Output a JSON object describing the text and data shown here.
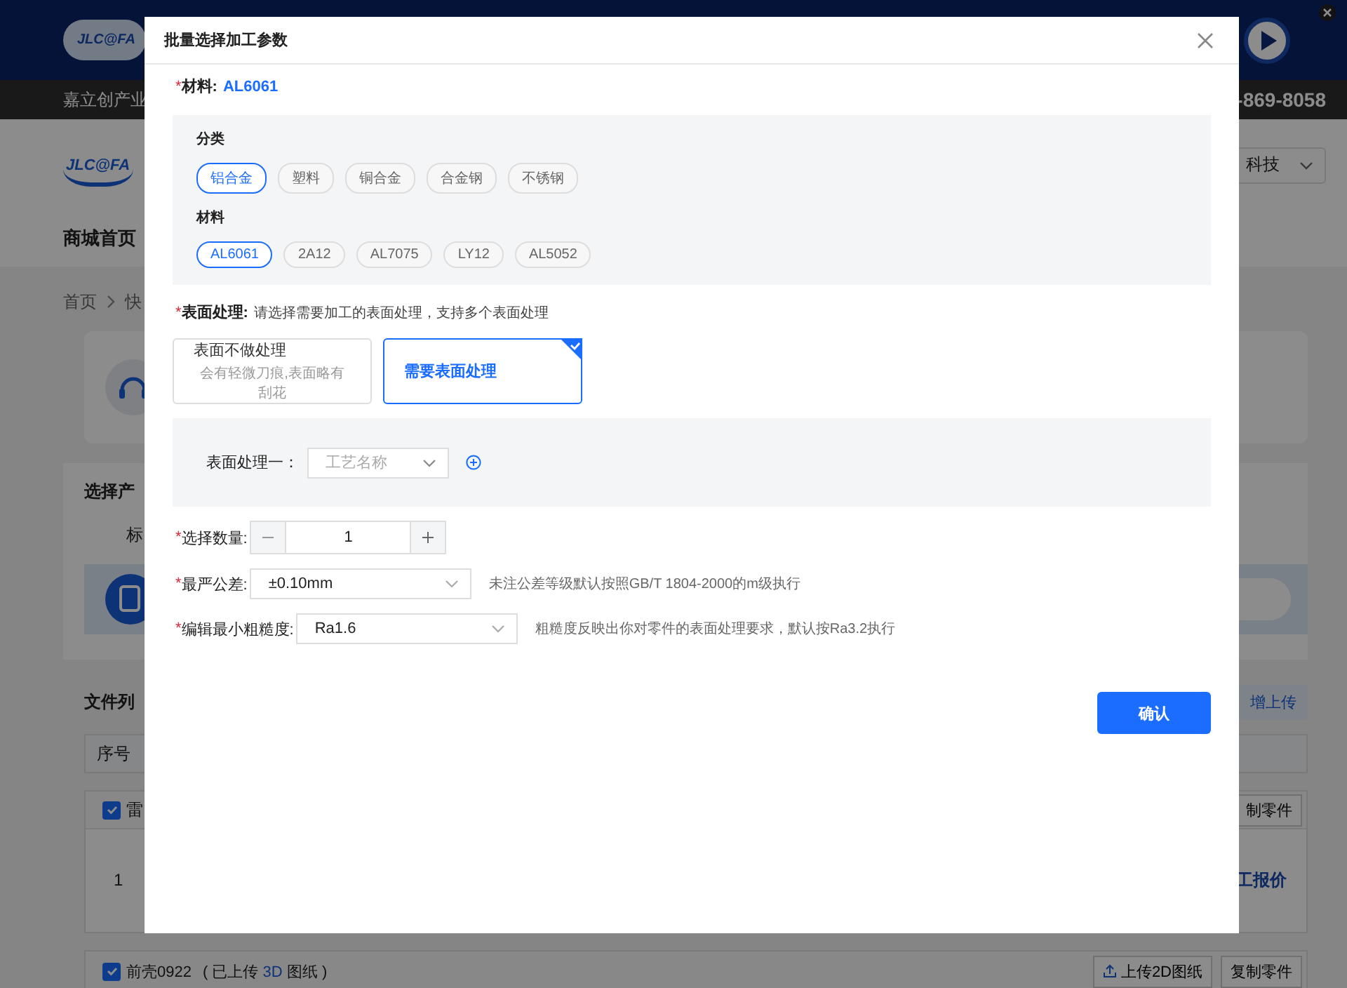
{
  "page": {
    "banner_logo": "JLC@FA",
    "top_bar": {
      "left": "嘉立创产业",
      "right": "-869-8058"
    },
    "header": {
      "logo": "JLC@FA",
      "account": "科技"
    },
    "nav": {
      "item": "商城首页"
    },
    "breadcrumb": [
      "首页",
      "快"
    ],
    "product_section": {
      "title": "选择产",
      "tab": "标"
    },
    "file_list": {
      "title": "文件列",
      "upload_button": "增上传",
      "column": "序号",
      "parts": [
        {
          "name": "雷",
          "checked": true,
          "copy_button": "制零件",
          "index": "1",
          "quote": "工报价"
        },
        {
          "name": "前壳0922",
          "checked": true,
          "note": "( 已上传 ",
          "note_link": "3D",
          "note_end": " 图纸 )",
          "upload_button": "上传2D图纸",
          "copy_button": "复制零件"
        }
      ]
    }
  },
  "dialog": {
    "title": "批量选择加工参数",
    "material": {
      "mark": "*",
      "label": "材料:",
      "value": "AL6061"
    },
    "category_label": "分类",
    "categories": [
      {
        "label": "铝合金",
        "selected": true
      },
      {
        "label": "塑料",
        "selected": false
      },
      {
        "label": "铜合金",
        "selected": false
      },
      {
        "label": "合金钢",
        "selected": false
      },
      {
        "label": "不锈钢",
        "selected": false
      }
    ],
    "materials_label": "材料",
    "materials": [
      {
        "label": "AL6061",
        "selected": true
      },
      {
        "label": "2A12",
        "selected": false
      },
      {
        "label": "AL7075",
        "selected": false
      },
      {
        "label": "LY12",
        "selected": false
      },
      {
        "label": "AL5052",
        "selected": false
      }
    ],
    "surface": {
      "mark": "*",
      "label": "表面处理:",
      "hint": "请选择需要加工的表面处理，支持多个表面处理"
    },
    "surface_options": [
      {
        "title": "表面不做处理",
        "subtitle": "会有轻微刀痕,表面略有刮花",
        "selected": false
      },
      {
        "title": "需要表面处理",
        "selected": true
      }
    ],
    "process": {
      "label": "表面处理一：",
      "placeholder": "工艺名称"
    },
    "quantity": {
      "mark": "*",
      "label": "选择数量:",
      "value": "1"
    },
    "tolerance": {
      "mark": "*",
      "label": "最严公差:",
      "value": "±0.10mm",
      "hint": "未注公差等级默认按照GB/T 1804-2000的m级执行"
    },
    "roughness": {
      "mark": "*",
      "label": "编辑最小粗糙度:",
      "value": "Ra1.6",
      "hint": "粗糙度反映出你对零件的表面处理要求，默认按Ra3.2执行"
    },
    "confirm": "确认"
  }
}
